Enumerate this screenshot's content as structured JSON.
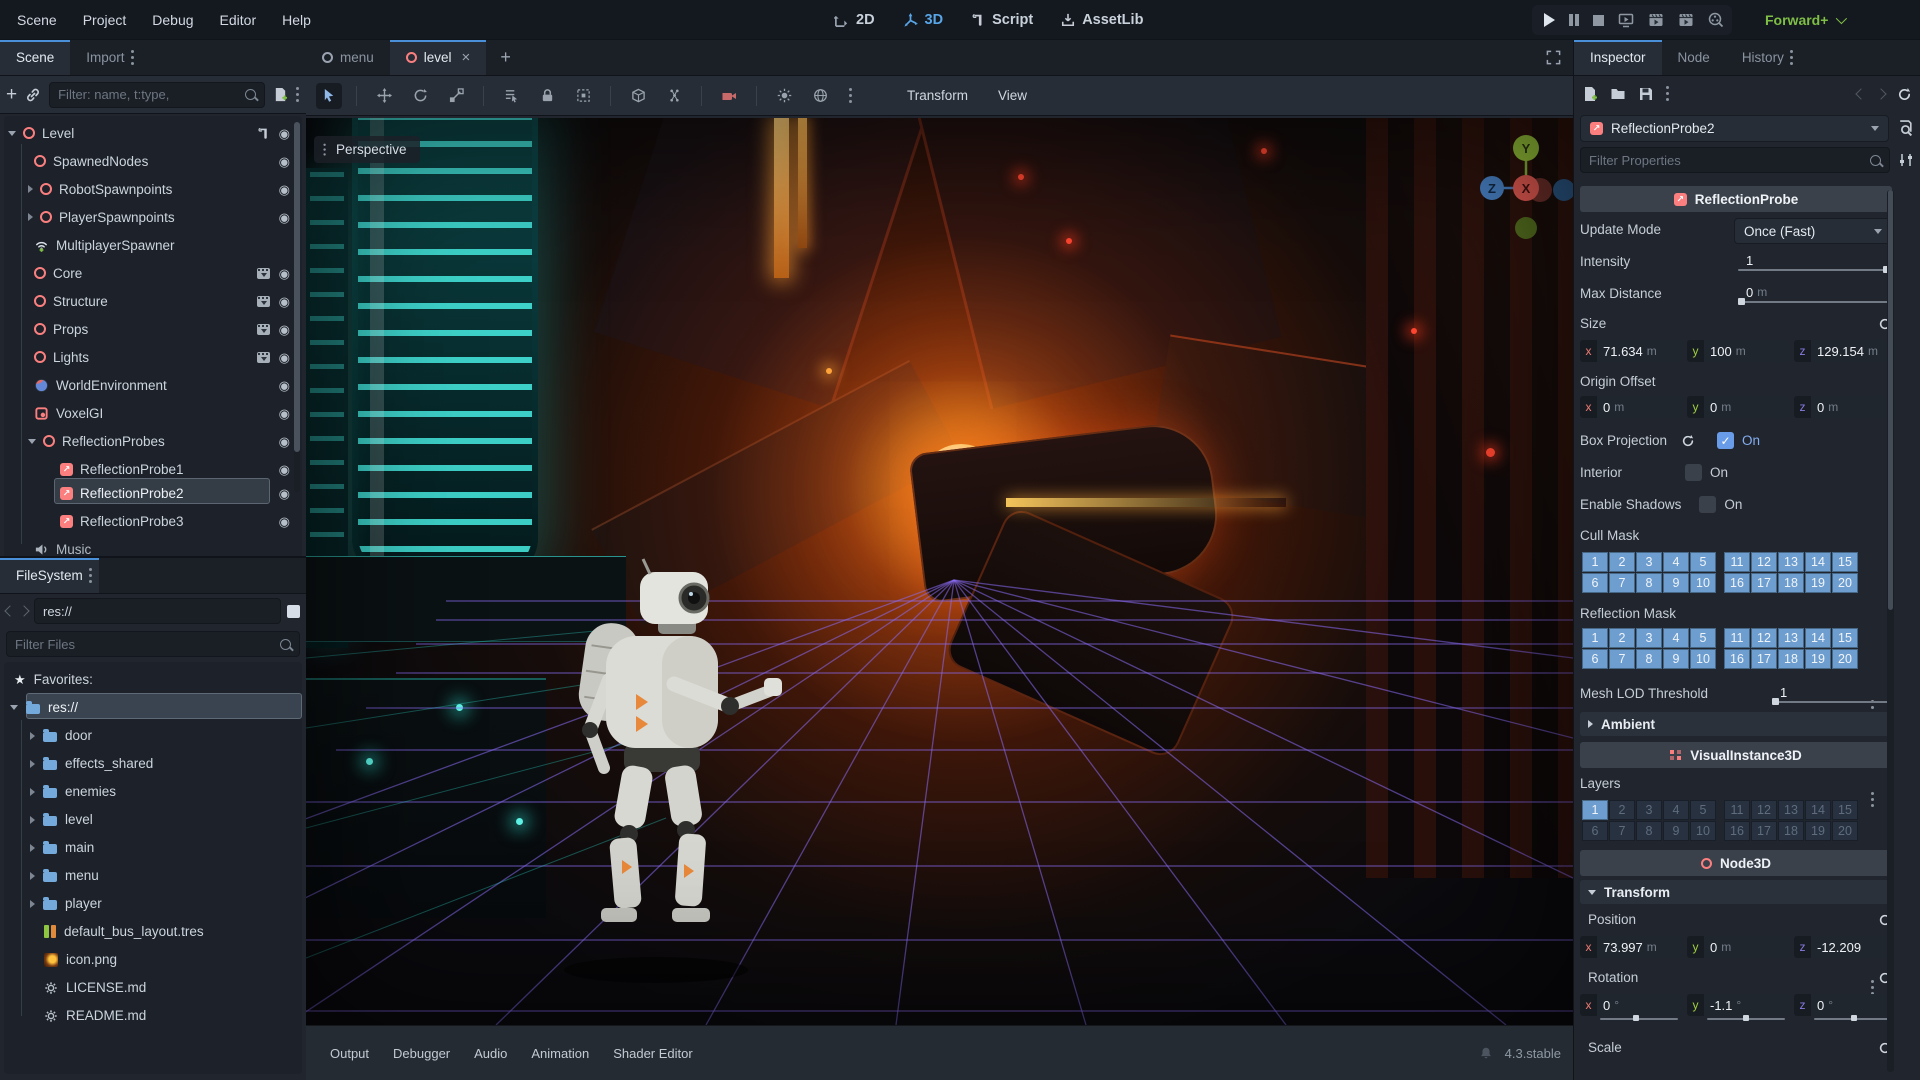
{
  "menubar": {
    "menus": [
      "Scene",
      "Project",
      "Debug",
      "Editor",
      "Help"
    ],
    "workspaces": {
      "w2d": "2D",
      "w3d": "3D",
      "script": "Script",
      "assetlib": "AssetLib"
    },
    "renderer": "Forward+"
  },
  "scene_dock": {
    "tab_scene": "Scene",
    "tab_import": "Import",
    "filter_placeholder": "Filter: name, t:type,",
    "tree": {
      "level": "Level",
      "spawnednodes": "SpawnedNodes",
      "robotspawnpoints": "RobotSpawnpoints",
      "playerspawnpoints": "PlayerSpawnpoints",
      "multiplayerspawner": "MultiplayerSpawner",
      "core": "Core",
      "structure": "Structure",
      "props": "Props",
      "lights": "Lights",
      "worldenvironment": "WorldEnvironment",
      "voxelgi": "VoxelGI",
      "reflectionprobes": "ReflectionProbes",
      "probe1": "ReflectionProbe1",
      "probe2": "ReflectionProbe2",
      "probe3": "ReflectionProbe3",
      "music": "Music"
    }
  },
  "filesystem": {
    "title": "FileSystem",
    "path": "res://",
    "filter_placeholder": "Filter Files",
    "favorites_label": "Favorites:",
    "root": "res://",
    "folders": [
      "door",
      "effects_shared",
      "enemies",
      "level",
      "main",
      "menu",
      "player"
    ],
    "files": {
      "bus": "default_bus_layout.tres",
      "icon": "icon.png",
      "license": "LICENSE.md",
      "readme": "README.md"
    }
  },
  "viewport": {
    "tab_menu": "menu",
    "tab_level": "level",
    "menu_transform": "Transform",
    "menu_view": "View",
    "perspective_label": "Perspective",
    "axis": {
      "x": "X",
      "y": "Y",
      "z": "Z"
    }
  },
  "bottom_bar": {
    "items": [
      "Output",
      "Debugger",
      "Audio",
      "Animation",
      "Shader Editor"
    ],
    "version": "4.3.stable"
  },
  "inspector": {
    "tab_inspector": "Inspector",
    "tab_node": "Node",
    "tab_history": "History",
    "node_name": "ReflectionProbe2",
    "filter_placeholder": "Filter Properties",
    "section_probe": "ReflectionProbe",
    "update_mode": {
      "label": "Update Mode",
      "value": "Once (Fast)"
    },
    "intensity": {
      "label": "Intensity",
      "value": "1"
    },
    "max_distance": {
      "label": "Max Distance",
      "value": "0",
      "unit": "m"
    },
    "size": {
      "label": "Size",
      "x": "71.634",
      "y": "100",
      "z": "129.154",
      "unit": "m"
    },
    "origin_offset": {
      "label": "Origin Offset",
      "x": "0",
      "y": "0",
      "z": "0",
      "unit": "m"
    },
    "box_projection": {
      "label": "Box Projection",
      "value": "On"
    },
    "interior": {
      "label": "Interior",
      "value": "On"
    },
    "enable_shadows": {
      "label": "Enable Shadows",
      "value": "On"
    },
    "cull_mask_label": "Cull Mask",
    "reflection_mask_label": "Reflection Mask",
    "mesh_lod": {
      "label": "Mesh LOD Threshold",
      "value": "1"
    },
    "ambient_label": "Ambient",
    "section_visual": "VisualInstance3D",
    "layers_label": "Layers",
    "section_node3d": "Node3D",
    "transform_label": "Transform",
    "position": {
      "label": "Position",
      "x": "73.997",
      "y": "0",
      "z": "-12.209",
      "unit": "m"
    },
    "rotation": {
      "label": "Rotation",
      "x": "0",
      "y": "-1.1",
      "z": "0",
      "unit": "°"
    },
    "scale_label": "Scale",
    "mask_a": [
      {
        "n": "1",
        "on": true
      },
      {
        "n": "2",
        "on": true
      },
      {
        "n": "3",
        "on": true
      },
      {
        "n": "4",
        "on": true
      },
      {
        "n": "5",
        "on": true
      }
    ],
    "mask_b": [
      {
        "n": "11",
        "on": true
      },
      {
        "n": "12",
        "on": true
      },
      {
        "n": "13",
        "on": true
      },
      {
        "n": "14",
        "on": true
      },
      {
        "n": "15",
        "on": true
      }
    ],
    "mask_c": [
      {
        "n": "6",
        "on": true
      },
      {
        "n": "7",
        "on": true
      },
      {
        "n": "8",
        "on": true
      },
      {
        "n": "9",
        "on": true
      },
      {
        "n": "10",
        "on": true
      }
    ],
    "mask_d": [
      {
        "n": "16",
        "on": true
      },
      {
        "n": "17",
        "on": true
      },
      {
        "n": "18",
        "on": true
      },
      {
        "n": "19",
        "on": true
      },
      {
        "n": "20",
        "on": true
      }
    ],
    "layers_a": [
      {
        "n": "1",
        "on": true
      },
      {
        "n": "2",
        "on": false
      },
      {
        "n": "3",
        "on": false
      },
      {
        "n": "4",
        "on": false
      },
      {
        "n": "5",
        "on": false
      }
    ],
    "layers_b": [
      {
        "n": "11",
        "on": false
      },
      {
        "n": "12",
        "on": false
      },
      {
        "n": "13",
        "on": false
      },
      {
        "n": "14",
        "on": false
      },
      {
        "n": "15",
        "on": false
      }
    ],
    "layers_c": [
      {
        "n": "6",
        "on": false
      },
      {
        "n": "7",
        "on": false
      },
      {
        "n": "8",
        "on": false
      },
      {
        "n": "9",
        "on": false
      },
      {
        "n": "10",
        "on": false
      }
    ],
    "layers_d": [
      {
        "n": "16",
        "on": false
      },
      {
        "n": "17",
        "on": false
      },
      {
        "n": "18",
        "on": false
      },
      {
        "n": "19",
        "on": false
      },
      {
        "n": "20",
        "on": false
      }
    ]
  },
  "colors": {
    "accent": "#4a90d9",
    "node_red": "#fc7f7f",
    "mask_blue": "#6e9ecf",
    "renderer_green": "#7fbf45",
    "axis_x": "#ed5e55",
    "axis_y": "#9fce3c",
    "axis_z": "#4a84c9"
  }
}
